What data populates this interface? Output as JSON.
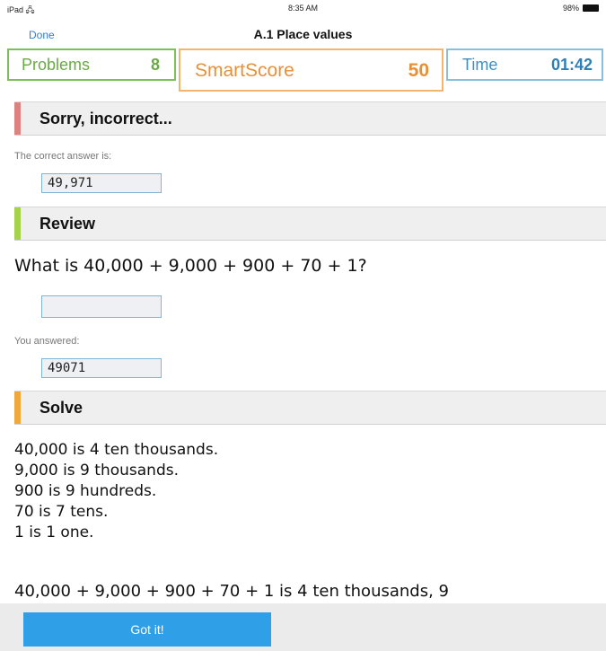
{
  "status": {
    "device": "iPad",
    "wifi_icon": "wifi-icon",
    "time": "8:35 AM",
    "battery": "98%"
  },
  "nav": {
    "done_label": "Done",
    "title": "A.1 Place values"
  },
  "stats": {
    "problems_label": "Problems",
    "problems_value": "8",
    "smartscore_label": "SmartScore",
    "smartscore_value": "50",
    "time_label": "Time",
    "time_value": "01:42"
  },
  "feedback": {
    "title": "Sorry, incorrect...",
    "correct_label": "The correct answer is:",
    "correct_answer": "49,971"
  },
  "review": {
    "title": "Review",
    "question": "What is 40,000 + 9,000 + 900 + 70 + 1?",
    "answer_placeholder": "",
    "you_answered_label": "You answered:",
    "you_answered": "49071"
  },
  "solve": {
    "title": "Solve",
    "lines": [
      "40,000 is 4 ten thousands.",
      "9,000 is 9 thousands.",
      "900 is 9 hundreds.",
      "70 is 7 tens.",
      "1 is 1 one."
    ],
    "summary": "40,000 + 9,000 + 900 + 70 + 1 is 4 ten thousands, 9"
  },
  "footer": {
    "got_it_label": "Got it!"
  },
  "colors": {
    "problems": "#6aaa45",
    "smartscore": "#e69138",
    "time": "#2e7fb6",
    "incorrect_bar": "#e08080",
    "review_bar": "#a6d24a",
    "solve_bar": "#f0a83c",
    "button": "#2f9fe8"
  }
}
